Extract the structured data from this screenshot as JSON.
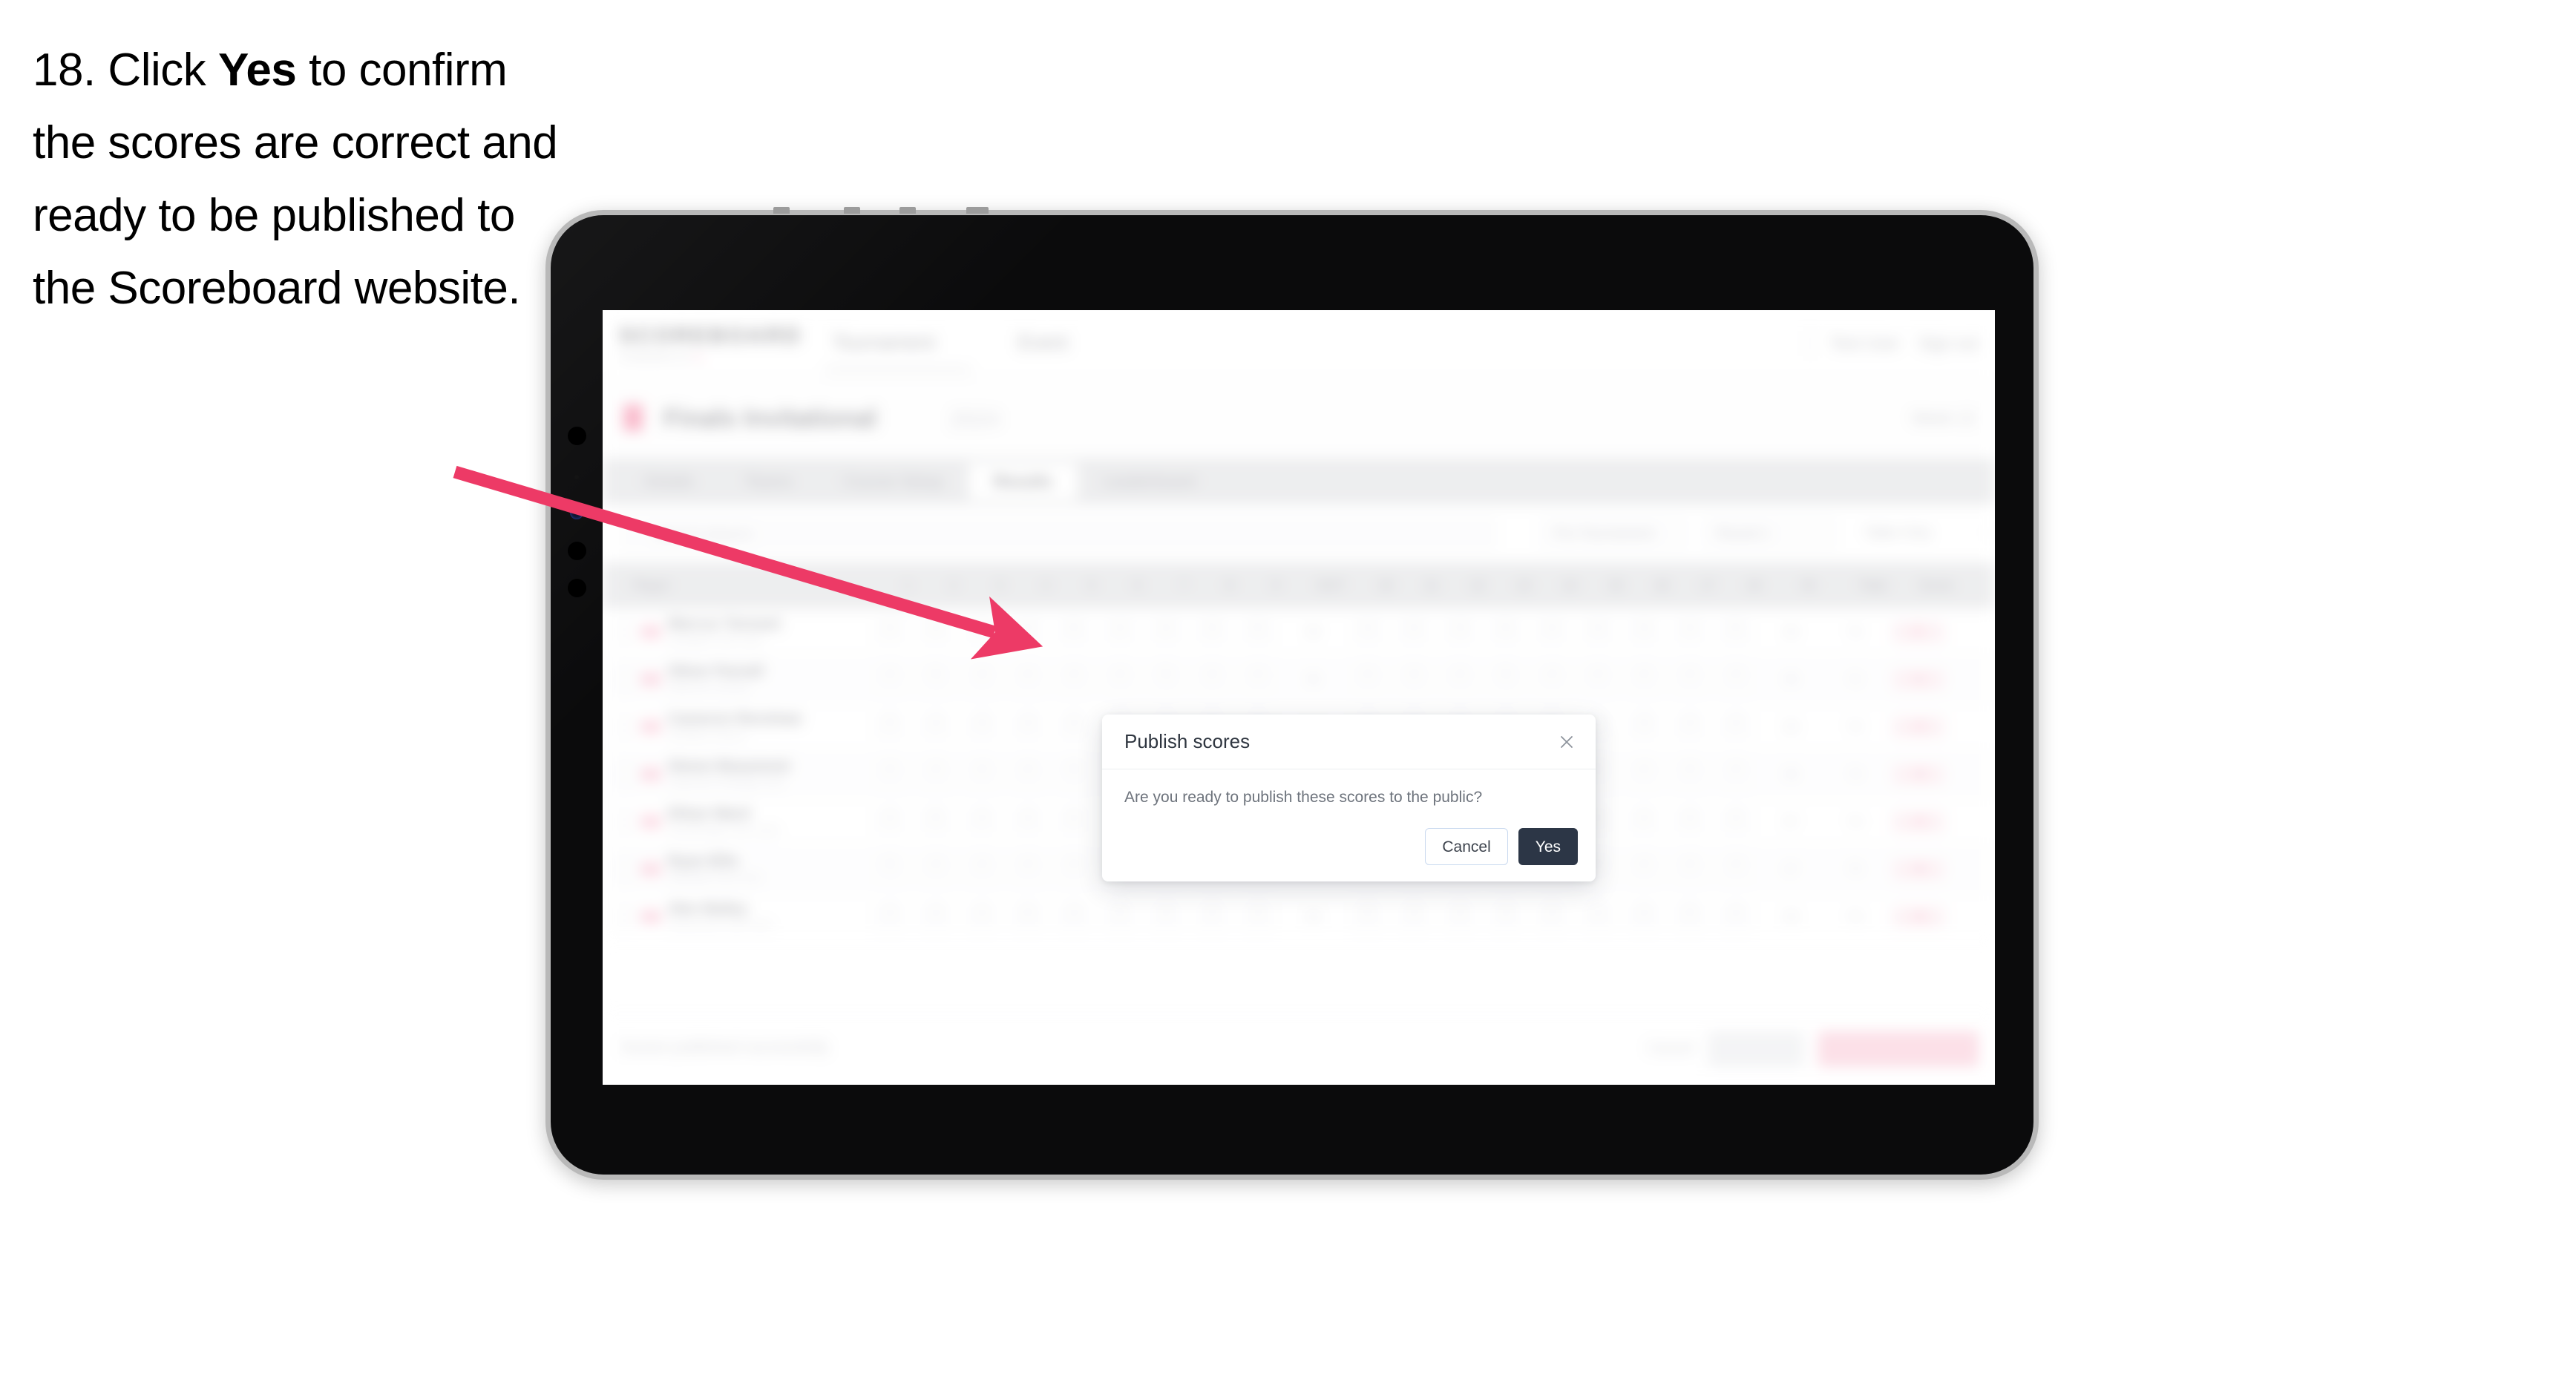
{
  "caption": {
    "step_number": "18.",
    "text_before": " Click ",
    "emphasis": "Yes",
    "text_after": " to confirm the scores are correct and ready to be published to the Scoreboard website."
  },
  "colors": {
    "accent_pink": "#f0386b",
    "arrow_pink": "#ed3a66",
    "primary_button": "#2c3646",
    "cancel_border": "#c9d9ef",
    "device_bezel": "#b9b9b9",
    "device_body": "#0b0b0c"
  },
  "device": {
    "name": "tablet-device",
    "camera_count": 5
  },
  "app": {
    "header": {
      "brand_word": "SCOREBOARD",
      "brand_sub": "POWERED BY",
      "brand_sub_dot": "●",
      "nav": [
        {
          "label": "Tournament"
        },
        {
          "label": "Event"
        }
      ],
      "right": [
        {
          "label": "Test User"
        },
        {
          "label": "Sign out"
        }
      ]
    },
    "event_bar": {
      "title": "Finals Invitational",
      "year": "2024",
      "right_label": "Week 12"
    },
    "tabs": [
      {
        "label": "Details",
        "active": false
      },
      {
        "label": "Teams",
        "active": false
      },
      {
        "label": "Course Setup",
        "active": false
      },
      {
        "label": "Results",
        "active": true
      },
      {
        "label": "Leaderboard",
        "active": false
      }
    ],
    "filter_bar": {
      "search_placeholder": "Search players",
      "filters": [
        {
          "label": "Pre-Tournament"
        },
        {
          "label": "Round 1"
        },
        {
          "label": "Table Only"
        },
        {
          "label": "⋮"
        }
      ]
    },
    "table": {
      "headers": [
        "Player",
        "1",
        "2",
        "3",
        "4",
        "5",
        "6",
        "7",
        "8",
        "9",
        "OUT",
        "10",
        "11",
        "12",
        "13",
        "14",
        "15",
        "16",
        "17",
        "18",
        "IN",
        "Total",
        "Score"
      ],
      "rows": [
        {
          "name": "Marcus Tennant",
          "club": "Eastgate Golf Club",
          "scores": [
            "4",
            "4",
            "3",
            "4",
            "5",
            "4",
            "4",
            "3",
            "5",
            "36",
            "4",
            "4",
            "3",
            "5",
            "4",
            "4",
            "3",
            "4",
            "5",
            "36",
            "72",
            "E"
          ],
          "total": "72",
          "score": "E"
        },
        {
          "name": "Oliver Parnell",
          "club": "Hillcrest Country",
          "scores": [
            "4",
            "5",
            "3",
            "4",
            "4",
            "4",
            "5",
            "3",
            "4",
            "36",
            "4",
            "3",
            "4",
            "5",
            "4",
            "4",
            "4",
            "4",
            "4",
            "36",
            "72",
            "+1"
          ],
          "total": "72",
          "score": "+1"
        },
        {
          "name": "Cameron Renshaw",
          "club": "Redlake Downs",
          "scores": [
            "5",
            "4",
            "3",
            "4",
            "4",
            "5",
            "4",
            "3",
            "4",
            "36",
            "4",
            "4",
            "4",
            "4",
            "5",
            "4",
            "3",
            "4",
            "4",
            "36",
            "72",
            "+2"
          ],
          "total": "72",
          "score": "+2"
        },
        {
          "name": "Simon Beaumont",
          "club": "Lakeview Heritage Golf",
          "scores": [
            "4",
            "4",
            "4",
            "4",
            "5",
            "4",
            "4",
            "4",
            "4",
            "37",
            "4",
            "4",
            "3",
            "4",
            "4",
            "5",
            "4",
            "4",
            "4",
            "36",
            "73",
            "+3"
          ],
          "total": "73",
          "score": "+3"
        },
        {
          "name": "Ethan Ward",
          "club": "Northbridge Golf Links",
          "scores": [
            "4",
            "5",
            "4",
            "4",
            "4",
            "4",
            "4",
            "3",
            "5",
            "37",
            "4",
            "5",
            "4",
            "4",
            "4",
            "4",
            "4",
            "4",
            "4",
            "37",
            "74",
            "+4"
          ],
          "total": "74",
          "score": "+4"
        },
        {
          "name": "Ryan Ellis",
          "club": "Whitfield Park Golf",
          "scores": [
            "5",
            "4",
            "4",
            "4",
            "4",
            "4",
            "5",
            "4",
            "4",
            "38",
            "4",
            "4",
            "4",
            "4",
            "5",
            "4",
            "4",
            "4",
            "4",
            "37",
            "75",
            "+5"
          ],
          "total": "75",
          "score": "+5"
        },
        {
          "name": "Alex Bailey",
          "club": "Stonecourt Golf Club",
          "scores": [
            "4",
            "4",
            "4",
            "5",
            "4",
            "5",
            "4",
            "4",
            "4",
            "38",
            "5",
            "4",
            "4",
            "4",
            "4",
            "4",
            "4",
            "5",
            "4",
            "38",
            "76",
            "+6"
          ],
          "total": "76",
          "score": "+6"
        }
      ]
    },
    "footer": {
      "note": "Scores published successfully",
      "link_label": "Cancel",
      "secondary_button": "Save all",
      "primary_button": "Publish scores to public"
    }
  },
  "modal": {
    "title": "Publish scores",
    "message": "Are you ready to publish these scores to the public?",
    "close_icon": "close-icon",
    "cancel_label": "Cancel",
    "confirm_label": "Yes"
  }
}
